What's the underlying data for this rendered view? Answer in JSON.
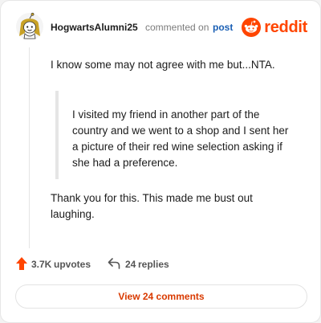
{
  "header": {
    "username": "HogwartsAlumni25",
    "action_text": "commented on",
    "post_link": "post",
    "brand_wordmark": "reddit",
    "avatar_icon": "snoo-avatar-icon",
    "brand_icon": "reddit-logo-icon"
  },
  "comment": {
    "paragraph1": "I know some may not agree with me but...NTA.",
    "quote": "I visited my friend in another part of the country and we went to a shop and I sent her a picture of their red wine selection asking if she had a preference.",
    "paragraph2": "Thank you for this. This made me bust out laughing."
  },
  "footer": {
    "upvote_count": "3.7K",
    "upvote_label": "upvotes",
    "reply_count": "24",
    "reply_label": "replies",
    "view_button_label": "View 24 comments",
    "upvote_icon": "upvote-arrow-icon",
    "reply_icon": "reply-arrow-icon"
  },
  "colors": {
    "brand": "#ff4500",
    "link": "#1a5fb4",
    "view_button_text": "#d93a00"
  }
}
